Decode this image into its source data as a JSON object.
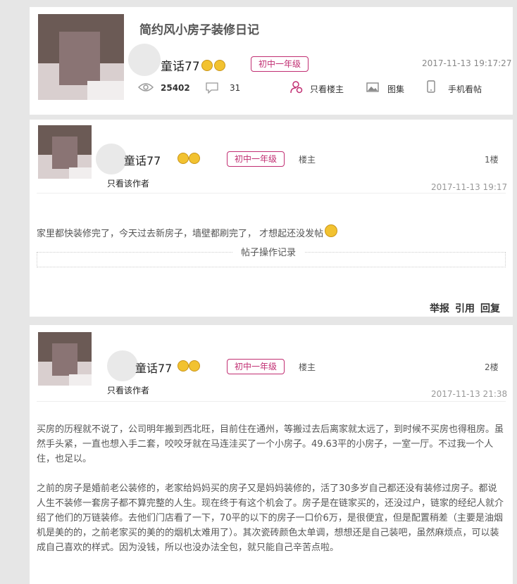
{
  "thread": {
    "title": "简约风小房子装修日记",
    "author": "童话77",
    "level": "初中一年级",
    "datetime": "2017-11-13 19:17:27",
    "views": "25402",
    "replies": "31",
    "actions": {
      "only_op": "只看楼主",
      "gallery": "图集",
      "mobile": "手机看帖"
    }
  },
  "posts": [
    {
      "author": "童话77",
      "level": "初中一年级",
      "role": "楼主",
      "floor": "1楼",
      "only_author": "只看该作者",
      "time": "2017-11-13 19:17",
      "content": [
        "家里都快装修完了，今天过去新房子，墙壁都刷完了， 才想起还没发帖"
      ],
      "record_label": "帖子操作记录",
      "actions": {
        "report": "举报",
        "quote": "引用",
        "reply": "回复"
      }
    },
    {
      "author": "童话77",
      "level": "初中一年级",
      "role": "楼主",
      "floor": "2楼",
      "only_author": "只看该作者",
      "time": "2017-11-13 21:38",
      "content": [
        "买房的历程就不说了，公司明年搬到西北旺，目前住在通州，等搬过去后离家就太远了，到时候不买房也得租房。虽然手头紧，一直也想入手二套，咬咬牙就在马连洼买了一个小房子。49.63平的小房子，一室一厅。不过我一个人住，也足以。",
        "之前的房子是婚前老公装修的，老家给妈妈买的房子又是妈妈装修的，活了30多岁自己都还没有装修过房子。都说人生不装修一套房子都不算完整的人生。现在终于有这个机会了。房子是在链家买的，还没过户，链家的经纪人就介绍了他们的万链装修。去他们门店看了一下，70平的以下的房子一口价6万，是很便宜，但是配置稍差（主要是油烟机是美的的，之前老家买的美的的烟机太难用了）。其次瓷砖颜色太单调，想想还是自己装吧，虽然麻烦点，可以装成自己喜欢的样式。因为没钱，所以也没办法全包，就只能自己辛苦点啦。"
      ]
    }
  ],
  "colors": {
    "accent": "#c12e72",
    "background": "#e6e6e6"
  },
  "icons": [
    "eye-icon",
    "comment-icon",
    "user-filter-icon",
    "image-icon",
    "phone-icon",
    "emoji-icon"
  ]
}
